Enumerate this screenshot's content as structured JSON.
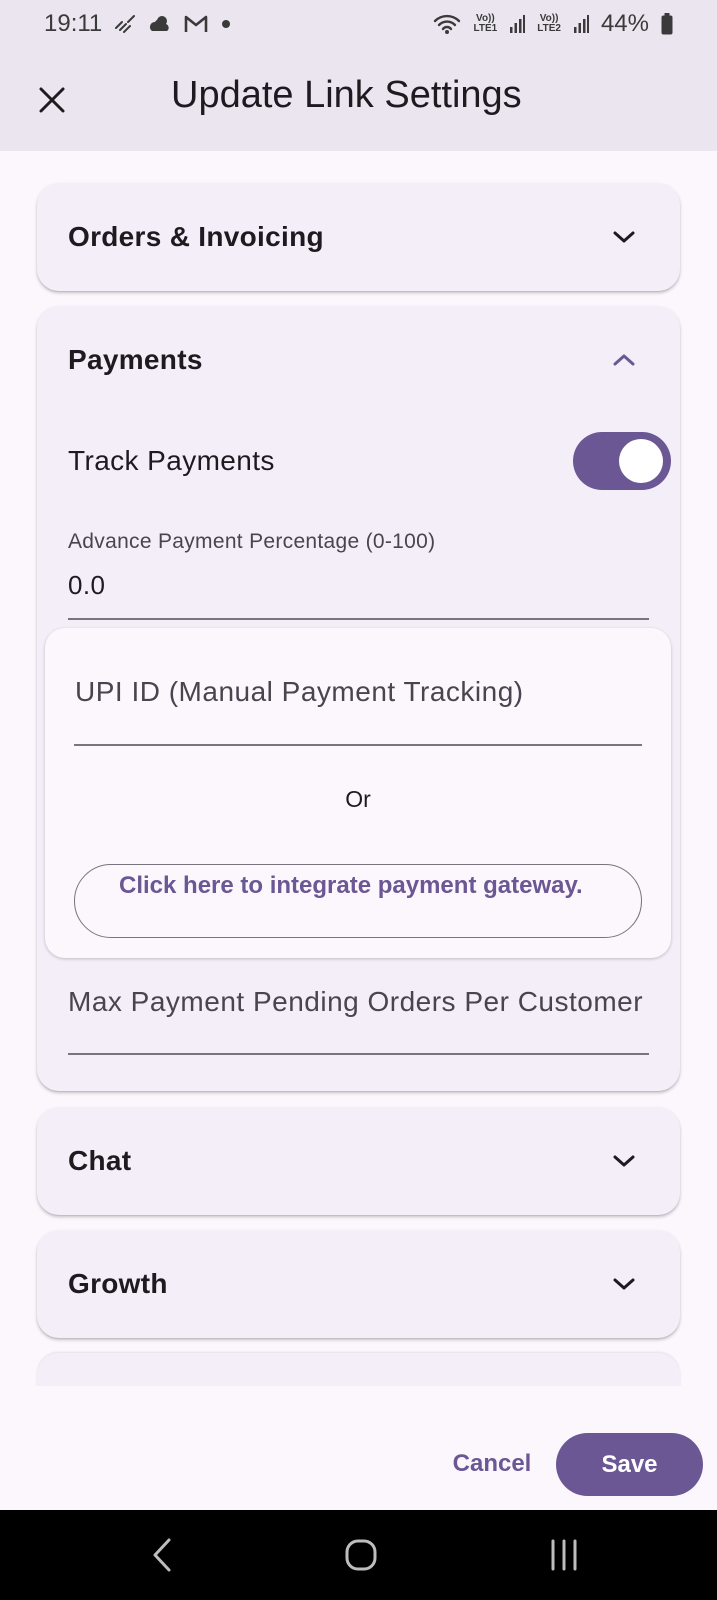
{
  "status_bar": {
    "time": "19:11",
    "net_1": "Vo))\nLTE1",
    "net_2": "Vo))\nLTE2",
    "battery": "44%",
    "icons": [
      "wifi-calling-icon",
      "weather-icon",
      "gmail-icon",
      "notification-dot-icon",
      "wifi-icon",
      "signal-icon",
      "battery-icon"
    ]
  },
  "app_bar": {
    "title": "Update Link Settings",
    "close_icon": "close-icon"
  },
  "sections": {
    "orders": {
      "title": "Orders & Invoicing",
      "expanded": false
    },
    "payments": {
      "title": "Payments",
      "expanded": true,
      "track_payments_label": "Track Payments",
      "track_payments_on": true,
      "advance_label": "Advance Payment Percentage (0-100)",
      "advance_value": "0.0",
      "upi_placeholder": "UPI ID (Manual Payment Tracking)",
      "or_text": "Or",
      "gateway_button": "Click here to integrate payment gateway.",
      "max_pending_placeholder": "Max Payment Pending Orders Per Customer"
    },
    "chat": {
      "title": "Chat",
      "expanded": false
    },
    "growth": {
      "title": "Growth",
      "expanded": false
    }
  },
  "actions": {
    "cancel": "Cancel",
    "save": "Save"
  },
  "colors": {
    "accent": "#6b5794",
    "app_bar_bg": "#ebe5ef",
    "card_bg": "#f4eef8",
    "page_bg": "#fcf7fd"
  }
}
